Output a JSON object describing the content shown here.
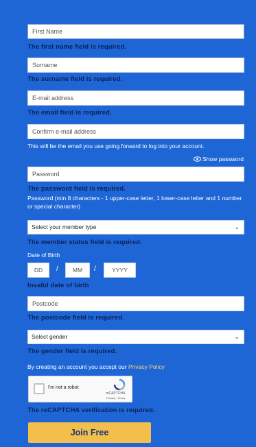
{
  "form": {
    "first_name": {
      "placeholder": "First Name",
      "error": "The first name field is required."
    },
    "surname": {
      "placeholder": "Surname",
      "error": "The surname field is required."
    },
    "email": {
      "placeholder": "E-mail address",
      "error": "The email field is required."
    },
    "confirm_email": {
      "placeholder": "Confirm e-mail address",
      "note": "This will be the email you use going forward to log into your account."
    },
    "show_password": "Show password",
    "password": {
      "placeholder": "Password",
      "error": "The password field is required.",
      "hint": "Password (min 8 characters - 1 upper-case letter, 1 lower-case letter and 1 number or special character)"
    },
    "member_type": {
      "value": "Select your member type",
      "error": "The member status field is required."
    },
    "dob": {
      "label": "Date of Birth",
      "dd": "DD",
      "mm": "MM",
      "yyyy": "YYYY",
      "sep": "/",
      "error": "Invalid date of birth"
    },
    "postcode": {
      "placeholder": "Postcode",
      "error": "The postcode field is required."
    },
    "gender": {
      "value": "Select gender",
      "error": "The gender field is required."
    },
    "terms": {
      "prefix": "By creating an account you accept our ",
      "link": "Privacy Policy"
    },
    "recaptcha": {
      "label": "I'm not a robot",
      "brand": "reCAPTCHA",
      "sub": "Privacy - Terms",
      "error": "The reCAPTCHA verification is required."
    },
    "submit": "Join Free"
  },
  "colors": {
    "background": "#1e66d6",
    "error_text": "#0e1f55",
    "button": "#f2bf4c",
    "link": "#f4d77a"
  }
}
